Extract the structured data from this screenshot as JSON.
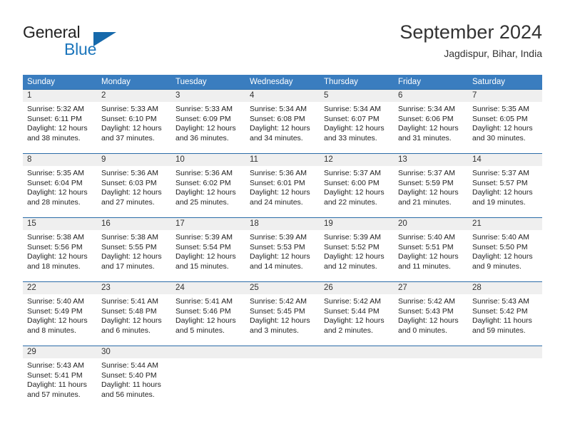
{
  "brand": {
    "name_part1": "General",
    "name_part2": "Blue",
    "accent_color": "#1b75bb",
    "logo_icon": "triangle-flag-icon"
  },
  "header": {
    "month_title": "September 2024",
    "location": "Jagdispur, Bihar, India"
  },
  "calendar": {
    "header_bg": "#3a7dbf",
    "row_border_color": "#2b6ca8",
    "day_band_bg": "#efefef",
    "day_names": [
      "Sunday",
      "Monday",
      "Tuesday",
      "Wednesday",
      "Thursday",
      "Friday",
      "Saturday"
    ],
    "weeks": [
      [
        {
          "day": "1",
          "sunrise": "Sunrise: 5:32 AM",
          "sunset": "Sunset: 6:11 PM",
          "daylight_line1": "Daylight: 12 hours",
          "daylight_line2": "and 38 minutes."
        },
        {
          "day": "2",
          "sunrise": "Sunrise: 5:33 AM",
          "sunset": "Sunset: 6:10 PM",
          "daylight_line1": "Daylight: 12 hours",
          "daylight_line2": "and 37 minutes."
        },
        {
          "day": "3",
          "sunrise": "Sunrise: 5:33 AM",
          "sunset": "Sunset: 6:09 PM",
          "daylight_line1": "Daylight: 12 hours",
          "daylight_line2": "and 36 minutes."
        },
        {
          "day": "4",
          "sunrise": "Sunrise: 5:34 AM",
          "sunset": "Sunset: 6:08 PM",
          "daylight_line1": "Daylight: 12 hours",
          "daylight_line2": "and 34 minutes."
        },
        {
          "day": "5",
          "sunrise": "Sunrise: 5:34 AM",
          "sunset": "Sunset: 6:07 PM",
          "daylight_line1": "Daylight: 12 hours",
          "daylight_line2": "and 33 minutes."
        },
        {
          "day": "6",
          "sunrise": "Sunrise: 5:34 AM",
          "sunset": "Sunset: 6:06 PM",
          "daylight_line1": "Daylight: 12 hours",
          "daylight_line2": "and 31 minutes."
        },
        {
          "day": "7",
          "sunrise": "Sunrise: 5:35 AM",
          "sunset": "Sunset: 6:05 PM",
          "daylight_line1": "Daylight: 12 hours",
          "daylight_line2": "and 30 minutes."
        }
      ],
      [
        {
          "day": "8",
          "sunrise": "Sunrise: 5:35 AM",
          "sunset": "Sunset: 6:04 PM",
          "daylight_line1": "Daylight: 12 hours",
          "daylight_line2": "and 28 minutes."
        },
        {
          "day": "9",
          "sunrise": "Sunrise: 5:36 AM",
          "sunset": "Sunset: 6:03 PM",
          "daylight_line1": "Daylight: 12 hours",
          "daylight_line2": "and 27 minutes."
        },
        {
          "day": "10",
          "sunrise": "Sunrise: 5:36 AM",
          "sunset": "Sunset: 6:02 PM",
          "daylight_line1": "Daylight: 12 hours",
          "daylight_line2": "and 25 minutes."
        },
        {
          "day": "11",
          "sunrise": "Sunrise: 5:36 AM",
          "sunset": "Sunset: 6:01 PM",
          "daylight_line1": "Daylight: 12 hours",
          "daylight_line2": "and 24 minutes."
        },
        {
          "day": "12",
          "sunrise": "Sunrise: 5:37 AM",
          "sunset": "Sunset: 6:00 PM",
          "daylight_line1": "Daylight: 12 hours",
          "daylight_line2": "and 22 minutes."
        },
        {
          "day": "13",
          "sunrise": "Sunrise: 5:37 AM",
          "sunset": "Sunset: 5:59 PM",
          "daylight_line1": "Daylight: 12 hours",
          "daylight_line2": "and 21 minutes."
        },
        {
          "day": "14",
          "sunrise": "Sunrise: 5:37 AM",
          "sunset": "Sunset: 5:57 PM",
          "daylight_line1": "Daylight: 12 hours",
          "daylight_line2": "and 19 minutes."
        }
      ],
      [
        {
          "day": "15",
          "sunrise": "Sunrise: 5:38 AM",
          "sunset": "Sunset: 5:56 PM",
          "daylight_line1": "Daylight: 12 hours",
          "daylight_line2": "and 18 minutes."
        },
        {
          "day": "16",
          "sunrise": "Sunrise: 5:38 AM",
          "sunset": "Sunset: 5:55 PM",
          "daylight_line1": "Daylight: 12 hours",
          "daylight_line2": "and 17 minutes."
        },
        {
          "day": "17",
          "sunrise": "Sunrise: 5:39 AM",
          "sunset": "Sunset: 5:54 PM",
          "daylight_line1": "Daylight: 12 hours",
          "daylight_line2": "and 15 minutes."
        },
        {
          "day": "18",
          "sunrise": "Sunrise: 5:39 AM",
          "sunset": "Sunset: 5:53 PM",
          "daylight_line1": "Daylight: 12 hours",
          "daylight_line2": "and 14 minutes."
        },
        {
          "day": "19",
          "sunrise": "Sunrise: 5:39 AM",
          "sunset": "Sunset: 5:52 PM",
          "daylight_line1": "Daylight: 12 hours",
          "daylight_line2": "and 12 minutes."
        },
        {
          "day": "20",
          "sunrise": "Sunrise: 5:40 AM",
          "sunset": "Sunset: 5:51 PM",
          "daylight_line1": "Daylight: 12 hours",
          "daylight_line2": "and 11 minutes."
        },
        {
          "day": "21",
          "sunrise": "Sunrise: 5:40 AM",
          "sunset": "Sunset: 5:50 PM",
          "daylight_line1": "Daylight: 12 hours",
          "daylight_line2": "and 9 minutes."
        }
      ],
      [
        {
          "day": "22",
          "sunrise": "Sunrise: 5:40 AM",
          "sunset": "Sunset: 5:49 PM",
          "daylight_line1": "Daylight: 12 hours",
          "daylight_line2": "and 8 minutes."
        },
        {
          "day": "23",
          "sunrise": "Sunrise: 5:41 AM",
          "sunset": "Sunset: 5:48 PM",
          "daylight_line1": "Daylight: 12 hours",
          "daylight_line2": "and 6 minutes."
        },
        {
          "day": "24",
          "sunrise": "Sunrise: 5:41 AM",
          "sunset": "Sunset: 5:46 PM",
          "daylight_line1": "Daylight: 12 hours",
          "daylight_line2": "and 5 minutes."
        },
        {
          "day": "25",
          "sunrise": "Sunrise: 5:42 AM",
          "sunset": "Sunset: 5:45 PM",
          "daylight_line1": "Daylight: 12 hours",
          "daylight_line2": "and 3 minutes."
        },
        {
          "day": "26",
          "sunrise": "Sunrise: 5:42 AM",
          "sunset": "Sunset: 5:44 PM",
          "daylight_line1": "Daylight: 12 hours",
          "daylight_line2": "and 2 minutes."
        },
        {
          "day": "27",
          "sunrise": "Sunrise: 5:42 AM",
          "sunset": "Sunset: 5:43 PM",
          "daylight_line1": "Daylight: 12 hours",
          "daylight_line2": "and 0 minutes."
        },
        {
          "day": "28",
          "sunrise": "Sunrise: 5:43 AM",
          "sunset": "Sunset: 5:42 PM",
          "daylight_line1": "Daylight: 11 hours",
          "daylight_line2": "and 59 minutes."
        }
      ],
      [
        {
          "day": "29",
          "sunrise": "Sunrise: 5:43 AM",
          "sunset": "Sunset: 5:41 PM",
          "daylight_line1": "Daylight: 11 hours",
          "daylight_line2": "and 57 minutes."
        },
        {
          "day": "30",
          "sunrise": "Sunrise: 5:44 AM",
          "sunset": "Sunset: 5:40 PM",
          "daylight_line1": "Daylight: 11 hours",
          "daylight_line2": "and 56 minutes."
        },
        {
          "day": "",
          "sunrise": "",
          "sunset": "",
          "daylight_line1": "",
          "daylight_line2": ""
        },
        {
          "day": "",
          "sunrise": "",
          "sunset": "",
          "daylight_line1": "",
          "daylight_line2": ""
        },
        {
          "day": "",
          "sunrise": "",
          "sunset": "",
          "daylight_line1": "",
          "daylight_line2": ""
        },
        {
          "day": "",
          "sunrise": "",
          "sunset": "",
          "daylight_line1": "",
          "daylight_line2": ""
        },
        {
          "day": "",
          "sunrise": "",
          "sunset": "",
          "daylight_line1": "",
          "daylight_line2": ""
        }
      ]
    ]
  }
}
